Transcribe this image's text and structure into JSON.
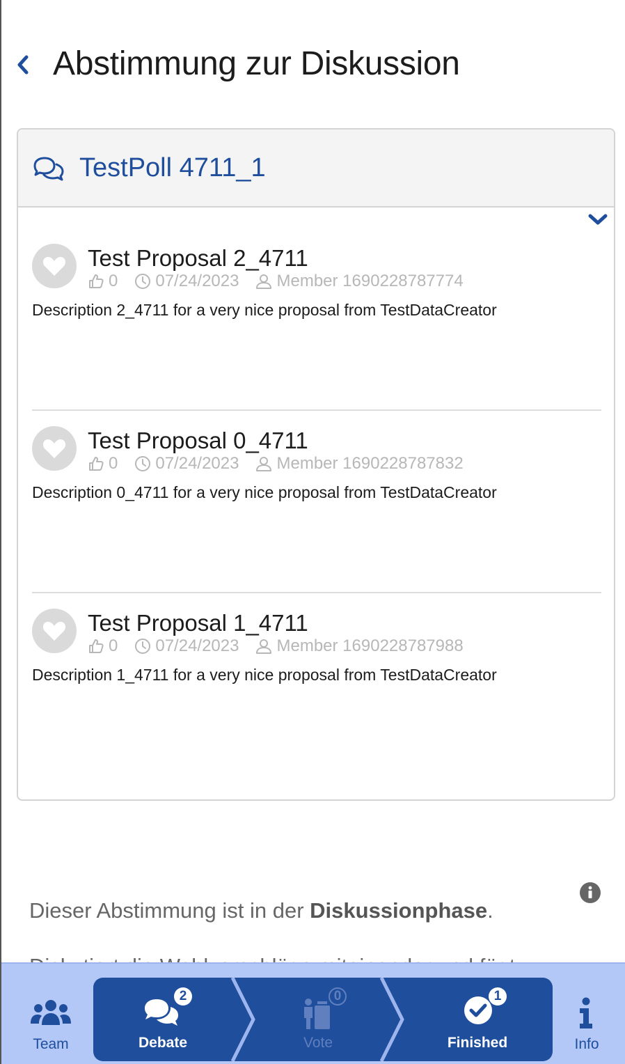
{
  "header": {
    "title": "Abstimmung zur Diskussion"
  },
  "poll": {
    "title": "TestPoll 4711_1",
    "proposals": [
      {
        "title": "Test Proposal 2_4711",
        "likes": "0",
        "date": "07/24/2023",
        "author": "Member 1690228787774",
        "description": "Description 2_4711 for a very nice proposal from TestDataCreator"
      },
      {
        "title": "Test Proposal 0_4711",
        "likes": "0",
        "date": "07/24/2023",
        "author": "Member 1690228787832",
        "description": "Description 0_4711 for a very nice proposal from TestDataCreator"
      },
      {
        "title": "Test Proposal 1_4711",
        "likes": "0",
        "date": "07/24/2023",
        "author": "Member 1690228787988",
        "description": "Description 1_4711 for a very nice proposal from TestDataCreator"
      }
    ]
  },
  "info": {
    "line1_prefix": "Dieser Abstimmung ist in der ",
    "line1_bold": "Diskussionphase",
    "line1_suffix": ".",
    "line2": "Diskutiert die Wahlvorschläge miteinander und fügt"
  },
  "tabbar": {
    "team": "Team",
    "debate": "Debate",
    "debate_badge": "2",
    "vote": "Vote",
    "vote_badge": "0",
    "finished": "Finished",
    "finished_badge": "1",
    "info": "Info"
  },
  "colors": {
    "primary": "#1f4e9c",
    "tabbar_bg": "#b3c8f6",
    "muted": "#b7b7b7"
  }
}
